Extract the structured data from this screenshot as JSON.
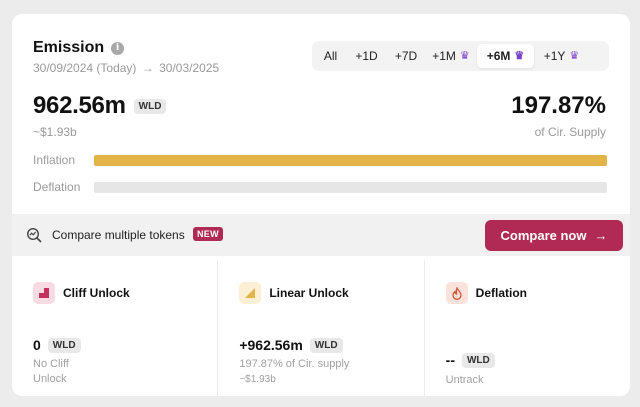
{
  "header": {
    "title": "Emission",
    "date_start": "30/09/2024 (Today)",
    "date_arrow": "→",
    "date_end": "30/03/2025"
  },
  "range_tabs": [
    {
      "label": "All",
      "premium": false,
      "active": false
    },
    {
      "label": "+1D",
      "premium": false,
      "active": false
    },
    {
      "label": "+7D",
      "premium": false,
      "active": false
    },
    {
      "label": "+1M",
      "premium": true,
      "active": false
    },
    {
      "label": "+6M",
      "premium": true,
      "active": true
    },
    {
      "label": "+1Y",
      "premium": true,
      "active": false
    }
  ],
  "summary": {
    "amount": "962.56m",
    "token": "WLD",
    "usd": "~$1.93b",
    "percent": "197.87%",
    "percent_label": "of Cir. Supply"
  },
  "bars": {
    "inflation_label": "Inflation",
    "inflation_fill": 1.0,
    "deflation_label": "Deflation",
    "deflation_fill": 0.0
  },
  "compare": {
    "text": "Compare multiple tokens",
    "badge": "NEW",
    "button": "Compare now",
    "button_arrow": "→"
  },
  "columns": {
    "cliff": {
      "title": "Cliff Unlock",
      "value": "0",
      "token": "WLD",
      "sub1": "No Cliff",
      "sub2": "Unlock"
    },
    "linear": {
      "title": "Linear Unlock",
      "value": "+962.56m",
      "token": "WLD",
      "sub1": "197.87% of Cir. supply",
      "sub2": "~$1.93b"
    },
    "deflation": {
      "title": "Deflation",
      "value": "--",
      "token": "WLD",
      "sub1": "Untrack"
    }
  },
  "colors": {
    "accent": "#b02a55",
    "inflation": "#e2b346",
    "crown": "#7a3fc9"
  }
}
